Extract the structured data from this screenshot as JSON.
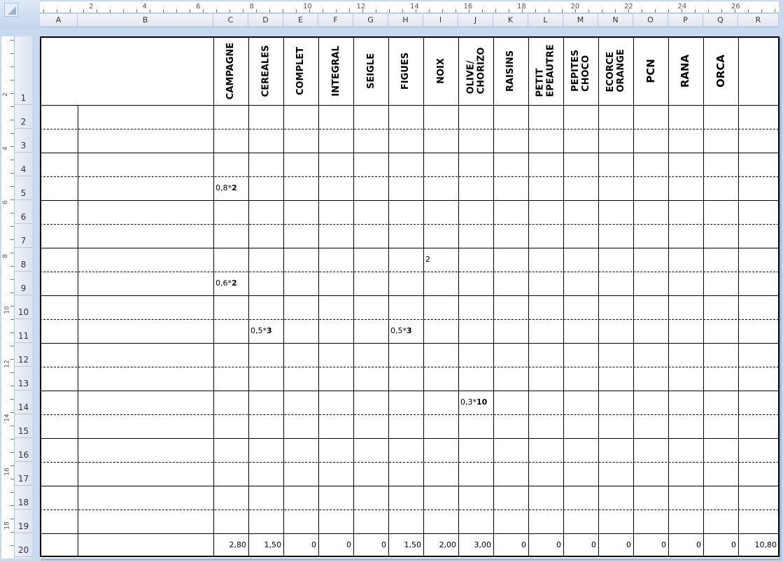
{
  "ruler_marks": [
    "2",
    "4",
    "6",
    "8",
    "10",
    "12",
    "14",
    "16",
    "18",
    "20",
    "22",
    "24",
    "26"
  ],
  "vruler_marks": [
    "2",
    "4",
    "6",
    "8",
    "10",
    "12",
    "14",
    "16",
    "18"
  ],
  "columns": [
    "A",
    "B",
    "C",
    "D",
    "E",
    "F",
    "G",
    "H",
    "I",
    "J",
    "K",
    "L",
    "M",
    "N",
    "O",
    "P",
    "Q",
    "R"
  ],
  "rows": [
    "1",
    "2",
    "3",
    "4",
    "5",
    "6",
    "7",
    "8",
    "9",
    "10",
    "11",
    "12",
    "13",
    "14",
    "15",
    "16",
    "17",
    "18",
    "19",
    "20"
  ],
  "headers": {
    "C": "CAMPAGNE",
    "D": "CEREALES",
    "E": "COMPLET",
    "F": "INTEGRAL",
    "G": "SEIGLE",
    "H": "FIGUES",
    "I": "NOIX",
    "J": "OLIVE/\nCHORIZO",
    "K": "RAISINS",
    "L": "PETIT\nEPEAUTRE",
    "M": "PEPITES\nCHOCO",
    "N": "ECORCE\nORANGE",
    "O": "PCN",
    "P": "RANA",
    "Q": "ORCA"
  },
  "entries": [
    {
      "row": 5,
      "col": "C",
      "text": "0,8*",
      "bold": "2"
    },
    {
      "row": 8,
      "col": "I",
      "text": "2",
      "bold": ""
    },
    {
      "row": 9,
      "col": "C",
      "text": "0,6*",
      "bold": "2"
    },
    {
      "row": 11,
      "col": "D",
      "text": "0,5*",
      "bold": "3"
    },
    {
      "row": 11,
      "col": "H",
      "text": "0,5*",
      "bold": "3"
    },
    {
      "row": 14,
      "col": "J",
      "text": "0,3*",
      "bold": "10"
    }
  ],
  "totals": {
    "C": "2,80",
    "D": "1,50",
    "E": "0",
    "F": "0",
    "G": "0",
    "H": "1,50",
    "I": "2,00",
    "J": "3,00",
    "K": "0",
    "L": "0",
    "M": "0",
    "N": "0",
    "O": "0",
    "P": "0",
    "Q": "0",
    "R": "10,80"
  }
}
